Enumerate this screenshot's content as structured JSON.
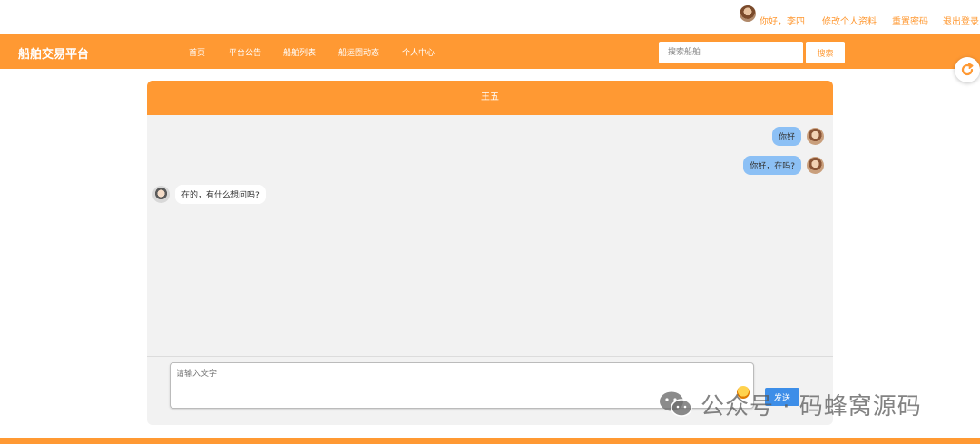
{
  "userbar": {
    "greeting": "你好，李四",
    "edit_profile": "修改个人资料",
    "reset_password": "重置密码",
    "logout": "退出登录"
  },
  "nav": {
    "brand": "船舶交易平台",
    "items": [
      {
        "label": "首页"
      },
      {
        "label": "平台公告"
      },
      {
        "label": "船舶列表"
      },
      {
        "label": "船运圈动态"
      },
      {
        "label": "个人中心"
      }
    ],
    "search_placeholder": "搜索船舶",
    "search_button": "搜索"
  },
  "chat": {
    "title": "王五",
    "messages": [
      {
        "direction": "out",
        "text": "你好"
      },
      {
        "direction": "out",
        "text": "你好，在吗?"
      },
      {
        "direction": "in",
        "text": "在的，有什么想问吗?"
      }
    ],
    "input_placeholder": "请输入文字",
    "send_button": "发送"
  },
  "watermark": {
    "text": "公众号 · 码蜂窝源码"
  },
  "colors": {
    "accent": "#ff9933",
    "bubble_out": "#8cc0f5",
    "send_button": "#3d8ee8",
    "chat_bg": "#f2f2f2"
  }
}
